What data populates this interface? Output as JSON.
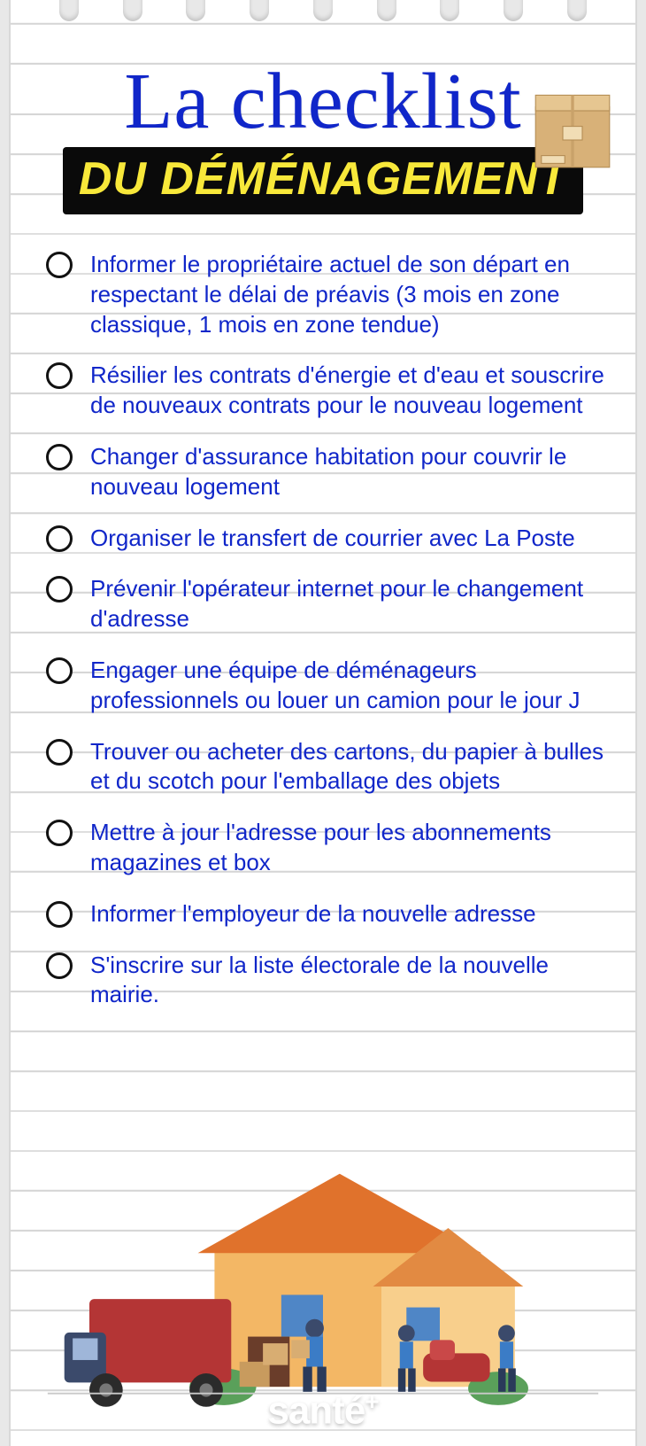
{
  "header": {
    "title_script": "La checklist",
    "title_bar": "DU DÉMÉNAGEMENT"
  },
  "checklist": {
    "items": [
      "Informer le propriétaire actuel de son départ en respectant le délai de préavis (3 mois en zone classique, 1 mois en zone tendue)",
      "Résilier les contrats d'énergie et d'eau et souscrire de nouveaux contrats pour le nouveau logement",
      "Changer d'assurance habitation pour couvrir le nouveau logement",
      "Organiser le transfert de courrier avec La Poste",
      "Prévenir l'opérateur internet pour le changement d'adresse",
      "Engager une équipe de déménageurs professionnels ou louer un camion pour le jour J",
      "Trouver ou acheter des cartons, du papier à bulles et du scotch pour l'emballage des objets",
      "Mettre à jour l'adresse pour les abonnements magazines et box",
      "Informer l'employeur de la nouvelle adresse",
      "S'inscrire sur la liste électorale de la nouvelle mairie."
    ]
  },
  "footer": {
    "logo_main": "santé",
    "logo_plus": "+"
  }
}
